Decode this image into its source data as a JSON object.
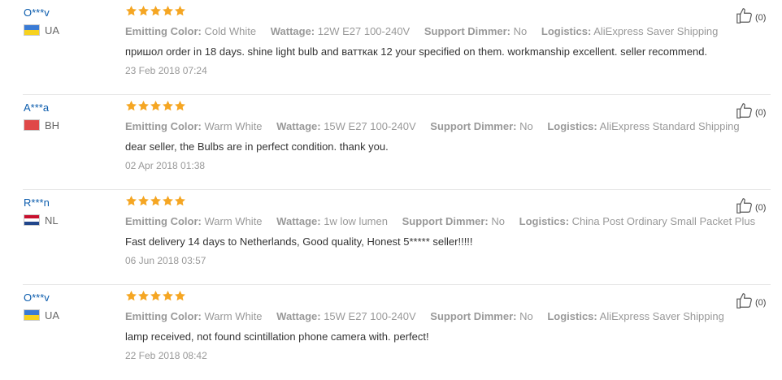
{
  "colors": {
    "name": "#0b5cad",
    "star": "#f5a623",
    "muted": "#999999"
  },
  "labels": {
    "emitting_color": "Emitting Color:",
    "wattage": "Wattage:",
    "support_dimmer": "Support Dimmer:",
    "logistics": "Logistics:"
  },
  "reviews": [
    {
      "user": "O***v",
      "country": "UA",
      "flag": "ua-flag-icon",
      "rating": 5,
      "emitting_color": "Cold White",
      "wattage": "12W E27 100-240V",
      "support_dimmer": "No",
      "logistics": "AliExpress Saver Shipping",
      "text": "пришол order in 18 days. shine light bulb and ватткак 12 your specified on them. workmanship excellent. seller recommend.",
      "date": "23 Feb 2018 07:24",
      "likes": "(0)"
    },
    {
      "user": "A***a",
      "country": "BH",
      "flag": "bh-flag-icon",
      "rating": 5,
      "emitting_color": "Warm White",
      "wattage": "15W E27 100-240V",
      "support_dimmer": "No",
      "logistics": "AliExpress Standard Shipping",
      "text": "dear seller, the Bulbs are in perfect condition. thank you.",
      "date": "02 Apr 2018 01:38",
      "likes": "(0)"
    },
    {
      "user": "R***n",
      "country": "NL",
      "flag": "nl-flag-icon",
      "rating": 5,
      "emitting_color": "Warm White",
      "wattage": "1w low lumen",
      "support_dimmer": "No",
      "logistics": "China Post Ordinary Small Packet Plus",
      "text": "Fast delivery 14 days to Netherlands, Good quality, Honest 5***** seller!!!!!",
      "date": "06 Jun 2018 03:57",
      "likes": "(0)"
    },
    {
      "user": "O***v",
      "country": "UA",
      "flag": "ua-flag-icon",
      "rating": 5,
      "emitting_color": "Warm White",
      "wattage": "15W E27 100-240V",
      "support_dimmer": "No",
      "logistics": "AliExpress Saver Shipping",
      "text": "lamp received, not found scintillation phone camera with. perfect!",
      "date": "22 Feb 2018 08:42",
      "likes": "(0)"
    }
  ]
}
